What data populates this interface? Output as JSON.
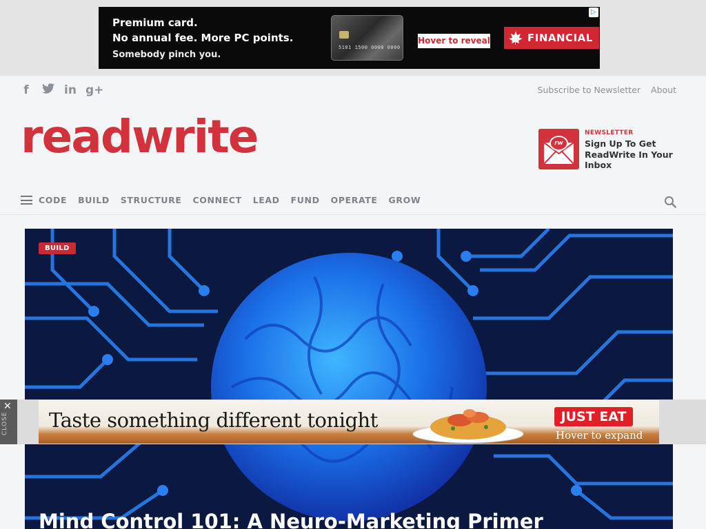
{
  "top_ad": {
    "headline_line1": "Premium card.",
    "headline_line2": "No annual fee. More PC  points.",
    "tagline": "Somebody pinch you.",
    "card_number": "5181 1500 0000 0000",
    "hover_label": "Hover to reveal",
    "brand": "FINANCIAL",
    "adchoices_icon": "adchoices-icon"
  },
  "header": {
    "social_icons": [
      "facebook-icon",
      "twitter-icon",
      "linkedin-icon",
      "google-plus-icon"
    ],
    "social_glyphs": [
      "f",
      "🐦",
      "in",
      "g+"
    ],
    "links": {
      "subscribe": "Subscribe to Newsletter",
      "about": "About"
    },
    "logo_text": "readwrite",
    "newsletter": {
      "kicker": "NEWSLETTER",
      "text": "Sign Up To Get ReadWrite In Your Inbox",
      "badge": "rw"
    }
  },
  "nav": {
    "items": [
      "CODE",
      "BUILD",
      "STRUCTURE",
      "CONNECT",
      "LEAD",
      "FUND",
      "OPERATE",
      "GROW"
    ]
  },
  "hero": {
    "category": "BUILD",
    "title": "Mind Control 101: A Neuro-Marketing Primer"
  },
  "bottom_ad": {
    "close_label": "CLOSE",
    "close_glyph": "✕",
    "headline": "Taste something different tonight",
    "brand": "JUST EAT",
    "hover_label": "Hover to expand"
  },
  "colors": {
    "brand_red": "#d2323c",
    "nav_gray": "#7d838b",
    "hero_bg": "#0b1840"
  }
}
